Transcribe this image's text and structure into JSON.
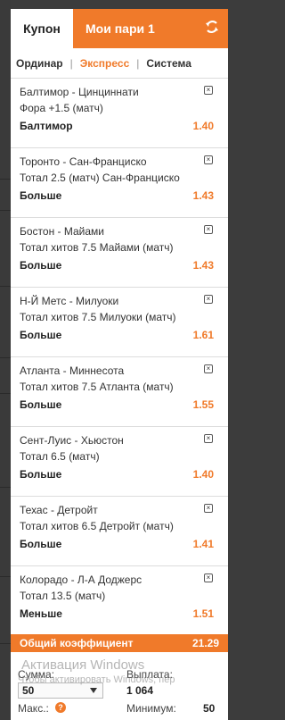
{
  "tabs": {
    "coupon": "Купон",
    "my_bets": "Мои пари 1"
  },
  "bet_types": {
    "single": "Ординар",
    "express": "Экспресс",
    "system": "Система",
    "active": "express"
  },
  "bets": [
    {
      "event": "Балтимор - Цинциннати",
      "market": "Фора +1.5 (матч)",
      "outcome": "Балтимор",
      "odds": "1.40"
    },
    {
      "event": "Торонто - Сан-Франциско",
      "market": "Тотал 2.5 (матч) Сан-Франциско",
      "outcome": "Больше",
      "odds": "1.43"
    },
    {
      "event": "Бостон - Майами",
      "market": "Тотал хитов 7.5 Майами (матч)",
      "outcome": "Больше",
      "odds": "1.43"
    },
    {
      "event": "Н-Й Метс - Милуоки",
      "market": "Тотал хитов 7.5 Милуоки (матч)",
      "outcome": "Больше",
      "odds": "1.61"
    },
    {
      "event": "Атланта - Миннесота",
      "market": "Тотал хитов 7.5 Атланта (матч)",
      "outcome": "Больше",
      "odds": "1.55"
    },
    {
      "event": "Сент-Луис - Хьюстон",
      "market": "Тотал 6.5 (матч)",
      "outcome": "Больше",
      "odds": "1.40"
    },
    {
      "event": "Техас - Детройт",
      "market": "Тотал хитов 6.5 Детройт (матч)",
      "outcome": "Больше",
      "odds": "1.41"
    },
    {
      "event": "Колорадо - Л-А Доджерс",
      "market": "Тотал 13.5 (матч)",
      "outcome": "Меньше",
      "odds": "1.51"
    }
  ],
  "total": {
    "label": "Общий коэффициент",
    "value": "21.29"
  },
  "footer": {
    "sum_label": "Сумма:",
    "sum_value": "50",
    "max_label": "Макс.:",
    "payout_label": "Выплата:",
    "payout_value": "1 064",
    "min_label": "Минимум:",
    "min_value": "50"
  },
  "watermark": {
    "line1": "Активация Windows",
    "line2": "Чтобы активировать Windows, пер"
  },
  "colors": {
    "accent": "#f07a2a",
    "dark": "#3c3c3c"
  }
}
